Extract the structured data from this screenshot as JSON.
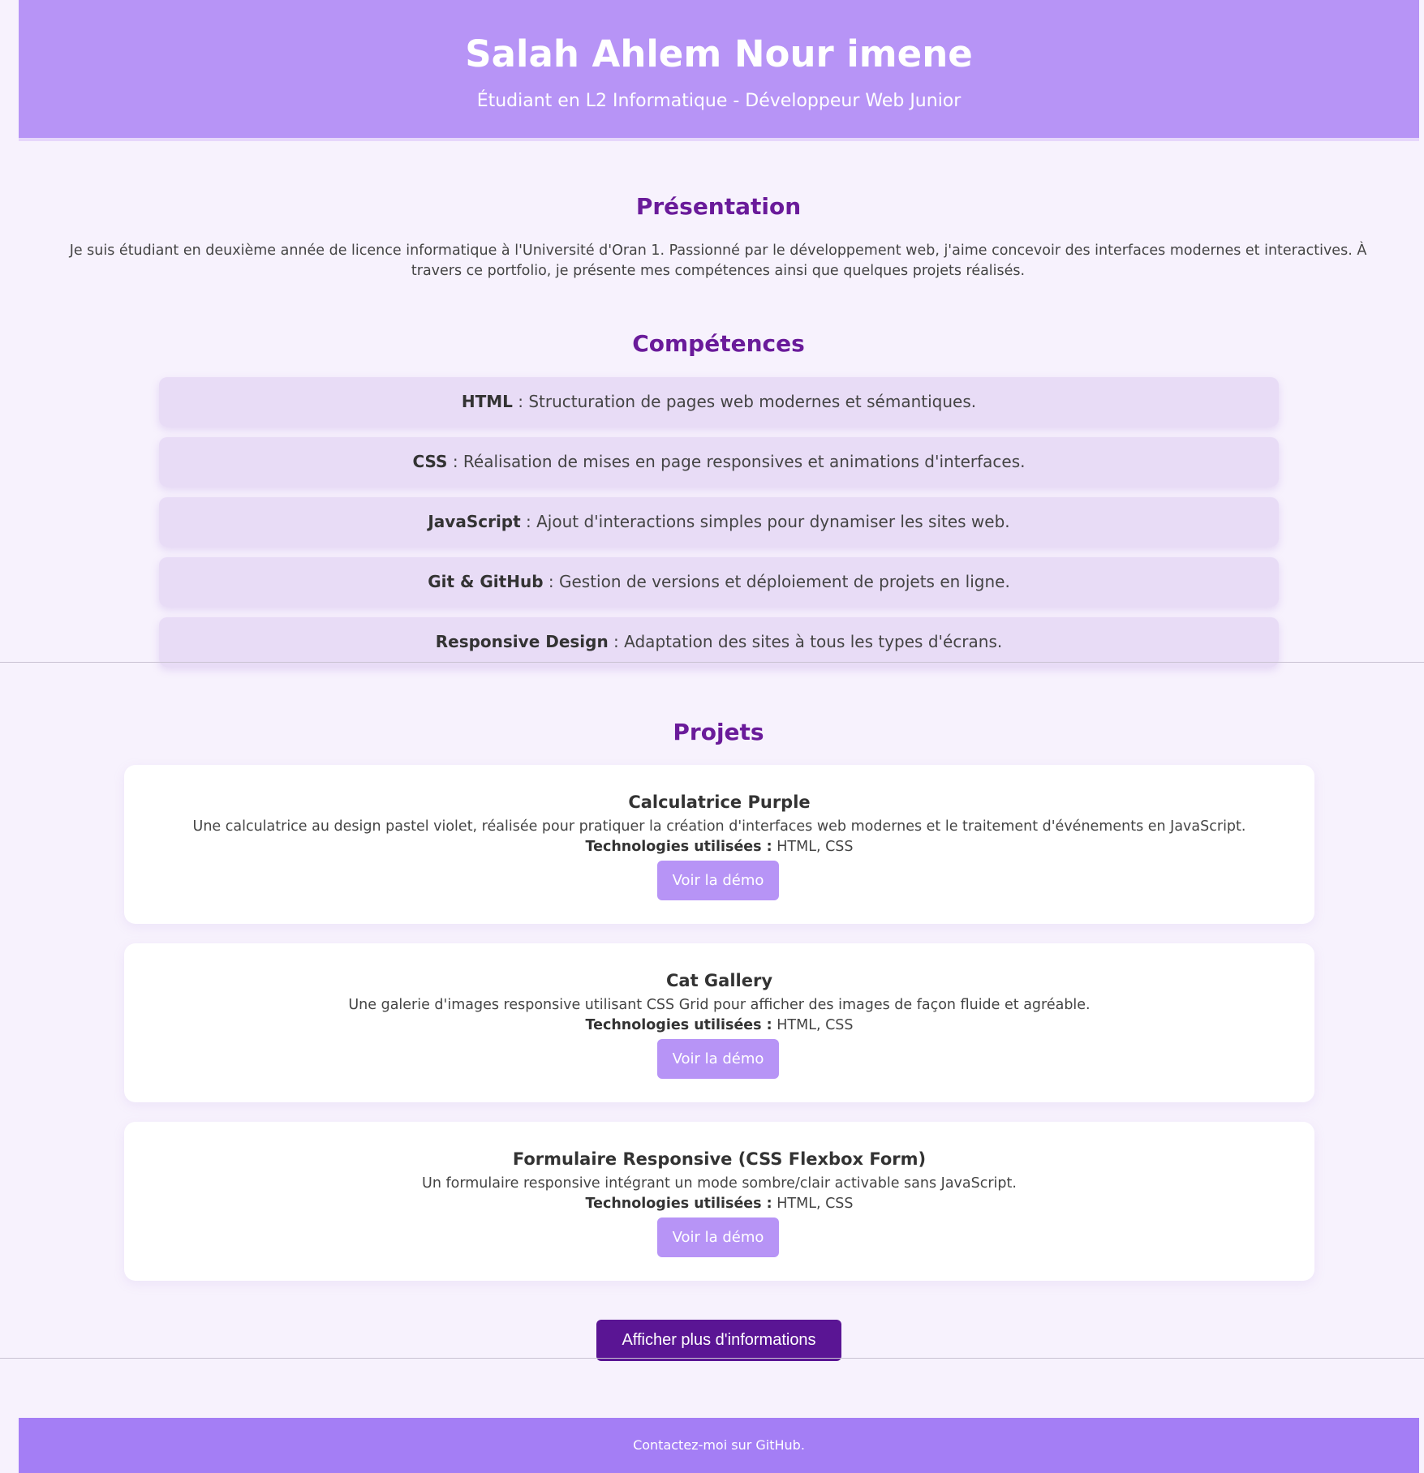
{
  "header": {
    "name": "Salah Ahlem Nour imene",
    "subtitle": "Étudiant en L2 Informatique - Développeur Web Junior"
  },
  "presentation": {
    "title": "Présentation",
    "text": "Je suis étudiant en deuxième année de licence informatique à l'Université d'Oran 1. Passionné par le développement web, j'aime concevoir des interfaces modernes et interactives. À travers ce portfolio, je présente mes compétences ainsi que quelques projets réalisés."
  },
  "skills": {
    "title": "Compétences",
    "items": [
      {
        "name": "HTML",
        "desc": " : Structuration de pages web modernes et sémantiques."
      },
      {
        "name": "CSS",
        "desc": " : Réalisation de mises en page responsives et animations d'interfaces."
      },
      {
        "name": "JavaScript",
        "desc": " : Ajout d'interactions simples pour dynamiser les sites web."
      },
      {
        "name": "Git & GitHub",
        "desc": " : Gestion de versions et déploiement de projets en ligne."
      },
      {
        "name": "Responsive Design",
        "desc": " : Adaptation des sites à tous les types d'écrans."
      }
    ]
  },
  "projects": {
    "title": "Projets",
    "tech_label": "Technologies utilisées :",
    "items": [
      {
        "title": "Calculatrice Purple",
        "desc": "Une calculatrice au design pastel violet, réalisée pour pratiquer la création d'interfaces web modernes et le traitement d'événements en JavaScript.",
        "tech": " HTML, CSS",
        "button": "Voir la démo"
      },
      {
        "title": "Cat Gallery",
        "desc": "Une galerie d'images responsive utilisant CSS Grid pour afficher des images de façon fluide et agréable.",
        "tech": " HTML, CSS",
        "button": "Voir la démo"
      },
      {
        "title": "Formulaire Responsive (CSS Flexbox Form)",
        "desc": "Un formulaire responsive intégrant un mode sombre/clair activable sans JavaScript.",
        "tech": " HTML, CSS",
        "button": "Voir la démo"
      }
    ]
  },
  "more_button": "Afficher plus d'informations",
  "footer": {
    "text": "Contactez-moi sur GitHub."
  },
  "colors": {
    "header_bg": "#b794f6",
    "accent_title": "#6a1b9a",
    "skill_bg": "#e8dcf6",
    "button_bg": "#b794f6",
    "more_button_bg": "#5a1594",
    "footer_bg": "#a47ef5",
    "page_bg": "#f7f2fd"
  }
}
